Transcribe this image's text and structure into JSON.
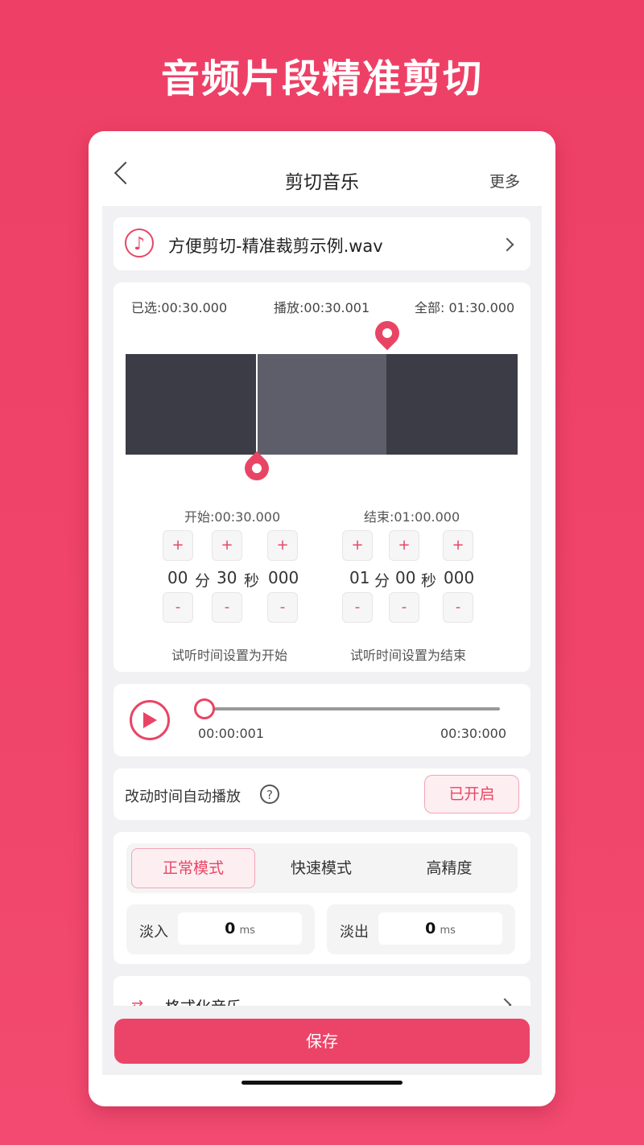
{
  "banner": {
    "title": "音频片段精准剪切"
  },
  "topbar": {
    "title": "剪切音乐",
    "more": "更多"
  },
  "file": {
    "name": "方便剪切-精准裁剪示例.wav"
  },
  "editor": {
    "selected": "已选:00:30.000",
    "playing": "播放:00:30.001",
    "total": "全部: 01:30.000",
    "start_label": "开始:00:30.000",
    "end_label": "结束:01:00.000",
    "start": {
      "min": "00",
      "sec": "30",
      "ms": "000"
    },
    "end": {
      "min": "01",
      "sec": "00",
      "ms": "000"
    },
    "unit_min": "分",
    "unit_sec": "秒",
    "plus": "+",
    "minus": "-",
    "set_start": "试听时间设置为开始",
    "set_end": "试听时间设置为结束",
    "colors": {
      "waveform_dark": "#3c3c47",
      "waveform_selected": "#5e5e6b",
      "accent": "#e84565"
    }
  },
  "player": {
    "current": "00:00:001",
    "duration": "00:30:000",
    "progress": 0.0
  },
  "autoplay": {
    "label": "改动时间自动播放",
    "help": "?",
    "toggle": "已开启"
  },
  "modes": {
    "normal": "正常模式",
    "fast": "快速模式",
    "precise": "高精度",
    "active": "normal"
  },
  "fade": {
    "in_label": "淡入",
    "in_value": "0",
    "out_label": "淡出",
    "out_value": "0",
    "unit": "ms"
  },
  "format": {
    "label": "格式化音乐"
  },
  "save": {
    "label": "保存"
  }
}
